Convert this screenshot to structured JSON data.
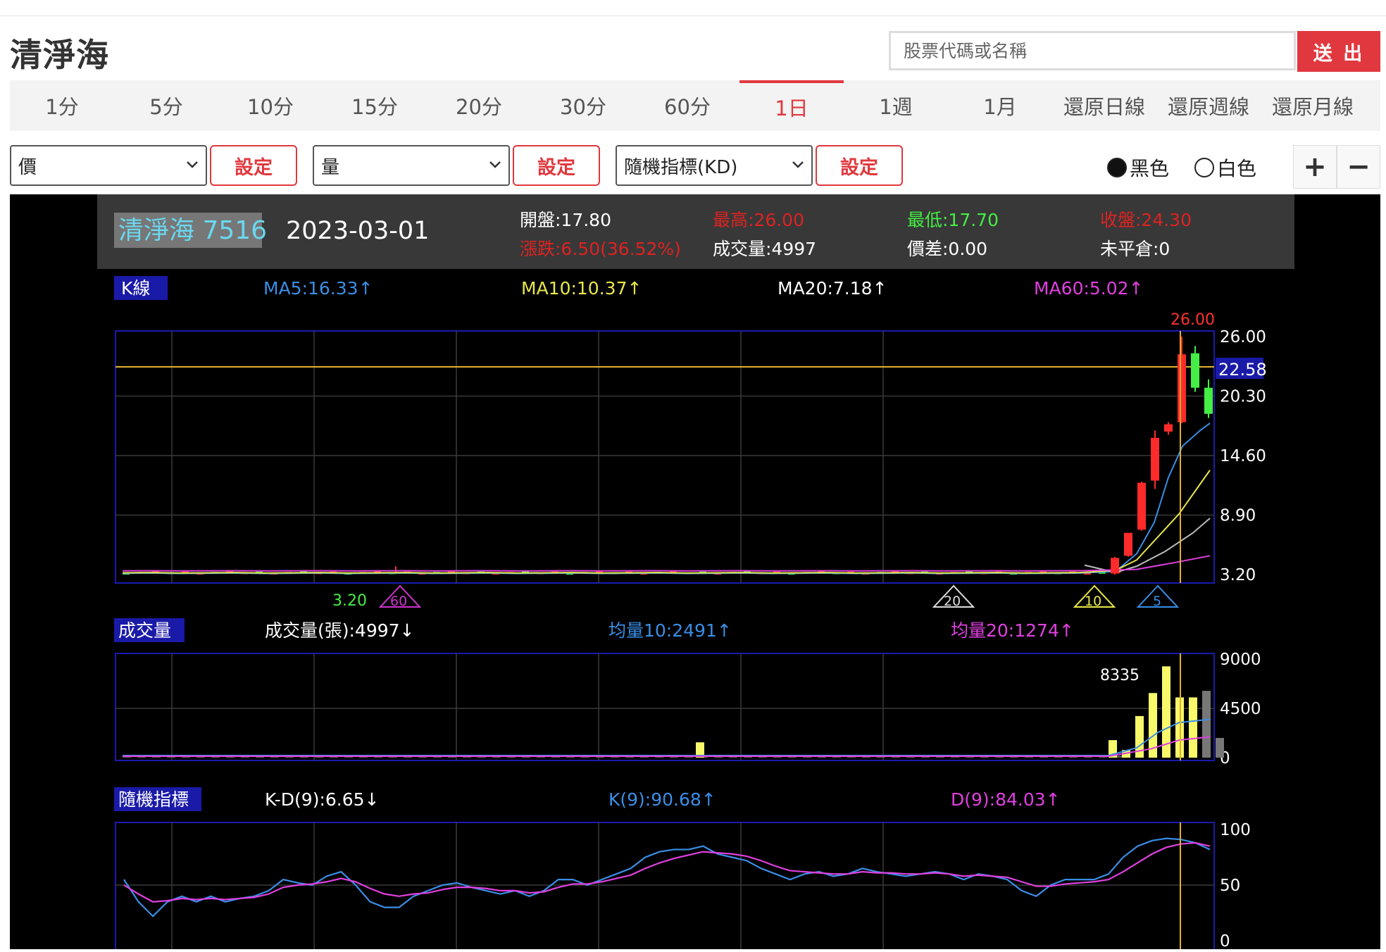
{
  "header": {
    "stock_title": "清淨海",
    "search_placeholder": "股票代碼或名稱",
    "submit_label": "送 出"
  },
  "period_tabs": [
    {
      "label": "1分",
      "active": false
    },
    {
      "label": "5分",
      "active": false
    },
    {
      "label": "10分",
      "active": false
    },
    {
      "label": "15分",
      "active": false
    },
    {
      "label": "20分",
      "active": false
    },
    {
      "label": "30分",
      "active": false
    },
    {
      "label": "60分",
      "active": false
    },
    {
      "label": "1日",
      "active": true
    },
    {
      "label": "1週",
      "active": false
    },
    {
      "label": "1月",
      "active": false
    },
    {
      "label": "還原日線",
      "active": false
    },
    {
      "label": "還原週線",
      "active": false
    },
    {
      "label": "還原月線",
      "active": false
    }
  ],
  "controls": {
    "select1": "價",
    "select2": "量",
    "select3": "隨機指標(KD)",
    "set_label": "設定",
    "theme_black": "黑色",
    "theme_white": "白色",
    "theme_selected": "黑色",
    "zoom_in": "+",
    "zoom_out": "−"
  },
  "info": {
    "stock_name": "清淨海 7516",
    "date": "2023-03-01",
    "open": "開盤:17.80",
    "high": "最高:26.00",
    "low": "最低:17.70",
    "close": "收盤:24.30",
    "change": "漲跌:6.50(36.52%)",
    "volume": "成交量:4997",
    "spread": "價差:0.00",
    "open_interest": "未平倉:0"
  },
  "kline": {
    "panel_label": "K線",
    "ma5": "MA5:16.33↑",
    "ma10": "MA10:10.37↑",
    "ma20": "MA20:7.18↑",
    "ma60": "MA60:5.02↑",
    "high_label": "26.00",
    "low_label": "3.20",
    "cursor_label": "22.58",
    "markers": [
      "60",
      "20",
      "10",
      "5"
    ]
  },
  "volume_panel": {
    "panel_label": "成交量",
    "vol": "成交量(張):4997↓",
    "avg10": "均量10:2491↑",
    "avg20": "均量20:1274↑",
    "peak_label": "8335"
  },
  "kd_panel": {
    "panel_label": "隨機指標",
    "kd_diff": "K-D(9):6.65↓",
    "k": "K(9):90.68↑",
    "d": "D(9):84.03↑"
  },
  "colors": {
    "accent": "#e0383e",
    "ma5": "#3a8ee6",
    "ma10": "#e8e84a",
    "ma20": "#bbbbbb",
    "ma60": "#e040e0",
    "up": "#ff2a2a",
    "down": "#44ee44"
  },
  "chart_data": [
    {
      "type": "candlestick",
      "title": "K線",
      "y_ticks": [
        26.0,
        20.3,
        14.6,
        8.9,
        3.2
      ],
      "ylim": [
        3.2,
        26.0
      ],
      "recent_candles": [
        {
          "open": 3.3,
          "high": 4.9,
          "low": 3.2,
          "close": 4.8
        },
        {
          "open": 5.0,
          "high": 7.2,
          "low": 4.9,
          "close": 7.2
        },
        {
          "open": 7.5,
          "high": 12.1,
          "low": 7.4,
          "close": 12.0
        },
        {
          "open": 12.2,
          "high": 17.0,
          "low": 11.4,
          "close": 16.3
        },
        {
          "open": 16.9,
          "high": 17.8,
          "low": 16.6,
          "close": 17.6
        },
        {
          "open": 17.8,
          "high": 26.0,
          "low": 17.7,
          "close": 24.3
        },
        {
          "open": 24.4,
          "high": 25.1,
          "low": 20.7,
          "close": 21.1
        },
        {
          "open": 21.1,
          "high": 21.9,
          "low": 18.2,
          "close": 18.6
        }
      ],
      "current_price_line": 22.58,
      "series": [
        {
          "name": "MA5",
          "last": 16.33
        },
        {
          "name": "MA10",
          "last": 10.37
        },
        {
          "name": "MA20",
          "last": 7.18
        },
        {
          "name": "MA60",
          "last": 5.02
        }
      ]
    },
    {
      "type": "bar",
      "title": "成交量",
      "y_ticks": [
        9000,
        4500,
        0
      ],
      "ylim": [
        0,
        9000
      ],
      "recent_values": [
        1600,
        700,
        3800,
        5900,
        8335,
        5500,
        5500,
        6100,
        1800
      ],
      "early_spike": 1400
    },
    {
      "type": "line",
      "title": "隨機指標",
      "y_ticks": [
        100,
        50,
        0
      ],
      "ylim": [
        0,
        100
      ],
      "series": [
        {
          "name": "K(9)",
          "values": [
            55,
            35,
            22,
            35,
            40,
            35,
            40,
            35,
            38,
            40,
            45,
            55,
            52,
            50,
            58,
            62,
            50,
            35,
            30,
            30,
            40,
            45,
            50,
            52,
            48,
            45,
            42,
            45,
            40,
            45,
            55,
            55,
            50,
            55,
            60,
            65,
            75,
            80,
            82,
            82,
            85,
            78,
            75,
            72,
            65,
            60,
            55,
            60,
            62,
            58,
            60,
            65,
            62,
            60,
            58,
            60,
            62,
            60,
            55,
            60,
            58,
            55,
            45,
            40,
            50,
            55,
            55,
            55,
            60,
            75,
            85,
            90,
            92,
            91,
            88,
            82
          ]
        },
        {
          "name": "D(9)",
          "values": [
            50,
            42,
            35,
            36,
            38,
            37,
            38,
            37,
            38,
            39,
            42,
            48,
            50,
            51,
            53,
            56,
            53,
            47,
            42,
            40,
            42,
            43,
            46,
            48,
            48,
            47,
            45,
            45,
            43,
            44,
            48,
            51,
            51,
            53,
            56,
            59,
            65,
            70,
            74,
            77,
            80,
            79,
            78,
            76,
            72,
            67,
            63,
            62,
            61,
            60,
            60,
            62,
            61,
            61,
            60,
            60,
            61,
            60,
            58,
            59,
            58,
            57,
            53,
            49,
            49,
            51,
            52,
            53,
            55,
            62,
            70,
            78,
            84,
            87,
            88,
            85
          ]
        }
      ]
    }
  ]
}
